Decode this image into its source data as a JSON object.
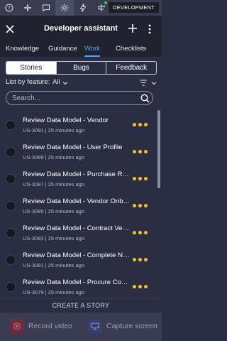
{
  "toolbar": {
    "icons": [
      "help-icon",
      "sparkle-icon",
      "chat-icon",
      "settings-spark-icon",
      "lightning-icon",
      "network-icon"
    ],
    "environment_label": "DEVELOPMENT"
  },
  "header": {
    "title": "Developer assistant"
  },
  "tabs": [
    {
      "label": "Knowledge"
    },
    {
      "label": "Guidance"
    },
    {
      "label": "Work"
    },
    {
      "label": "Checklists"
    }
  ],
  "segments": [
    {
      "label": "Stories"
    },
    {
      "label": "Bugs"
    },
    {
      "label": "Feedback"
    }
  ],
  "filter": {
    "label": "List by feature:",
    "value": "All"
  },
  "search": {
    "placeholder": "Search..."
  },
  "items": [
    {
      "title": "Review Data Model - Vendor",
      "sub": "US-3091 | 25 minutes ago"
    },
    {
      "title": "Review Data Model - User Profile",
      "sub": "US-3089 | 25 minutes ago"
    },
    {
      "title": "Review Data Model - Purchase Requ...",
      "sub": "US-3087 | 25 minutes ago"
    },
    {
      "title": "Review Data Model - Vendor Onboar...",
      "sub": "US-3085 | 25 minutes ago"
    },
    {
      "title": "Review Data Model - Contract Vendor",
      "sub": "US-3083 | 25 minutes ago"
    },
    {
      "title": "Review Data Model - Complete NDA",
      "sub": "US-3081 | 25 minutes ago"
    },
    {
      "title": "Review Data Model - Procure Comm...",
      "sub": "US-3079 | 25 minutes ago"
    }
  ],
  "footer": {
    "create_label": "CREATE A STORY",
    "record_label": "Record video",
    "capture_label": "Capture screen"
  },
  "colors": {
    "accent": "#4ea3ff",
    "menu_dots": "#f2c12e",
    "status_green": "#30c95b"
  }
}
